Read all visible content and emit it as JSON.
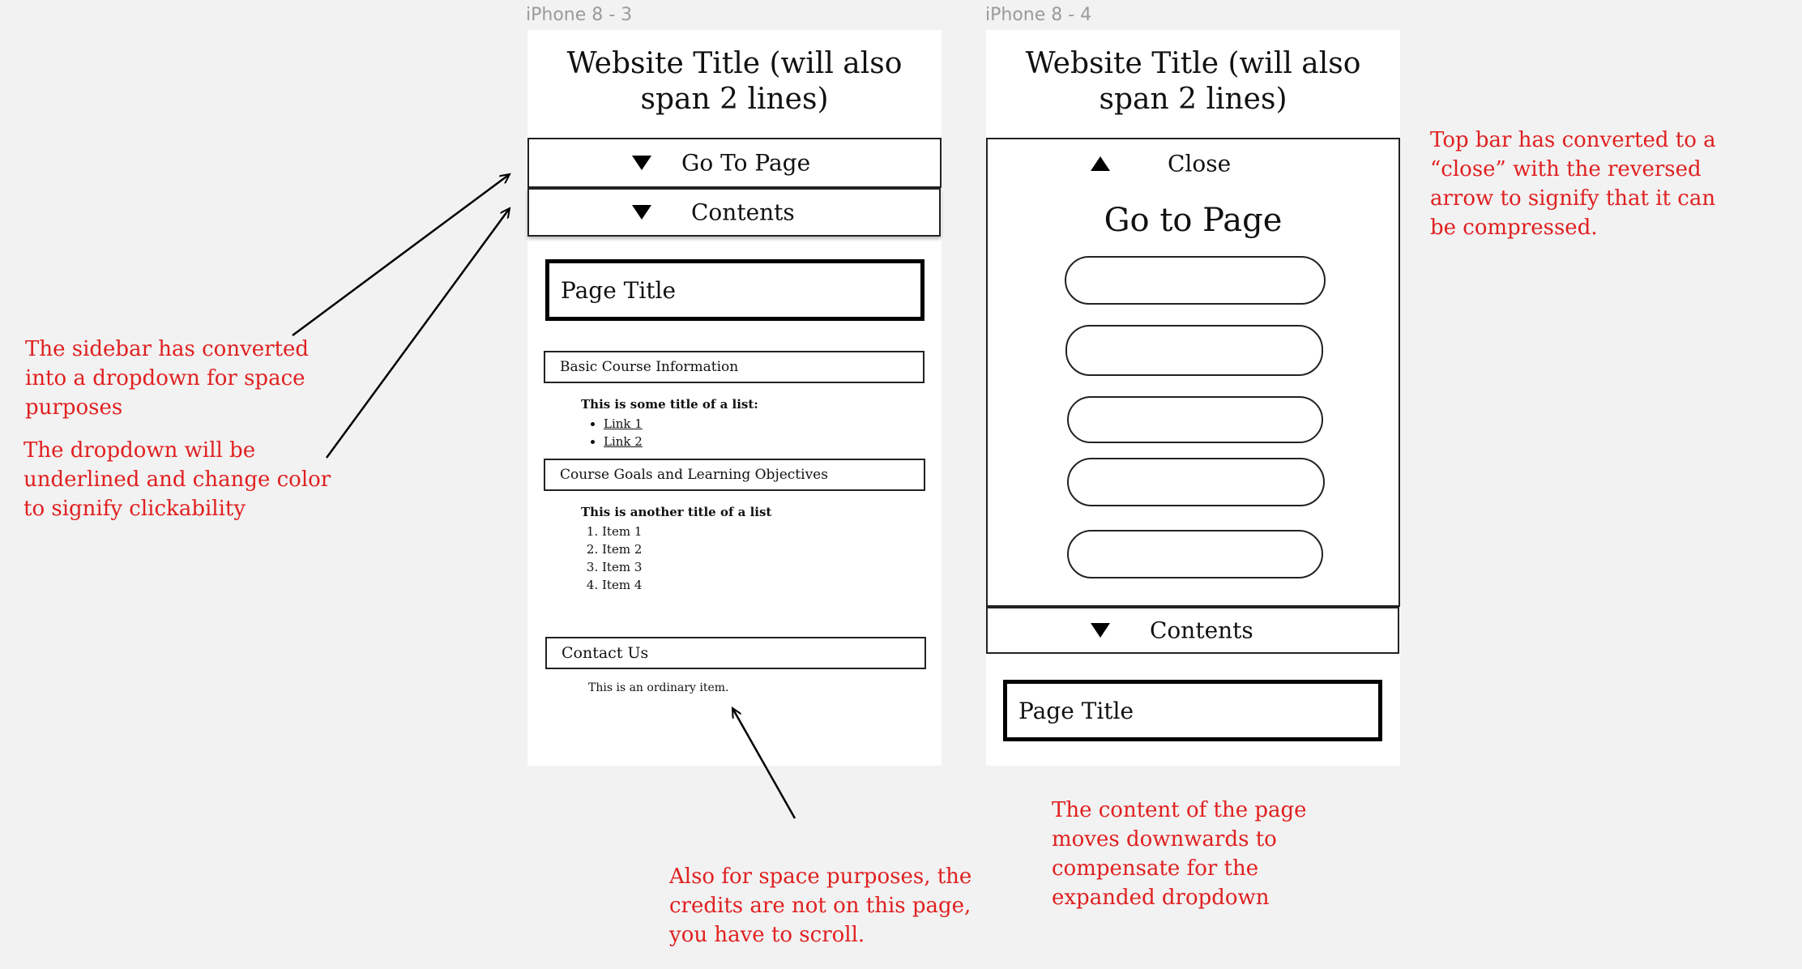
{
  "frames": {
    "left": {
      "label": "iPhone 8 - 3",
      "site_title": "Website Title (will also span 2 lines)",
      "go_to_page_bar": "Go To Page",
      "contents_bar": "Contents",
      "page_title": "Page Title",
      "section1": "Basic Course Information",
      "list1_title": "This is some title of a list:",
      "list1_items": [
        "Link 1",
        "Link 2"
      ],
      "section2": "Course Goals and Learning Objectives",
      "list2_title": "This is another title of a list",
      "list2_items": [
        "Item 1",
        "Item 2",
        "Item 3",
        "Item 4"
      ],
      "section3": "Contact Us",
      "ordinary_item": "This is an ordinary item."
    },
    "right": {
      "label": "iPhone 8 - 4",
      "site_title": "Website Title (will also span 2 lines)",
      "close_bar": "Close",
      "go_to_page_heading": "Go to Page",
      "contents_bar": "Contents",
      "page_title": "Page Title"
    }
  },
  "notes": {
    "sidebar": "The sidebar has converted into a dropdown for space purposes",
    "dropdown": "The dropdown will be underlined and change color to signify clickability",
    "credits": "Also for space purposes, the credits are not on this page, you have to scroll.",
    "close": "Top bar has converted to a “close” with the reversed arrow to signify that it can be compressed.",
    "content_moves": "The content of the page moves downwards to compensate for the expanded dropdown"
  },
  "colors": {
    "annotation": "#e02020",
    "canvas": "#f2f2f2",
    "frame": "#ffffff"
  },
  "icons": {
    "down": "down-triangle-icon",
    "up": "up-triangle-icon"
  }
}
